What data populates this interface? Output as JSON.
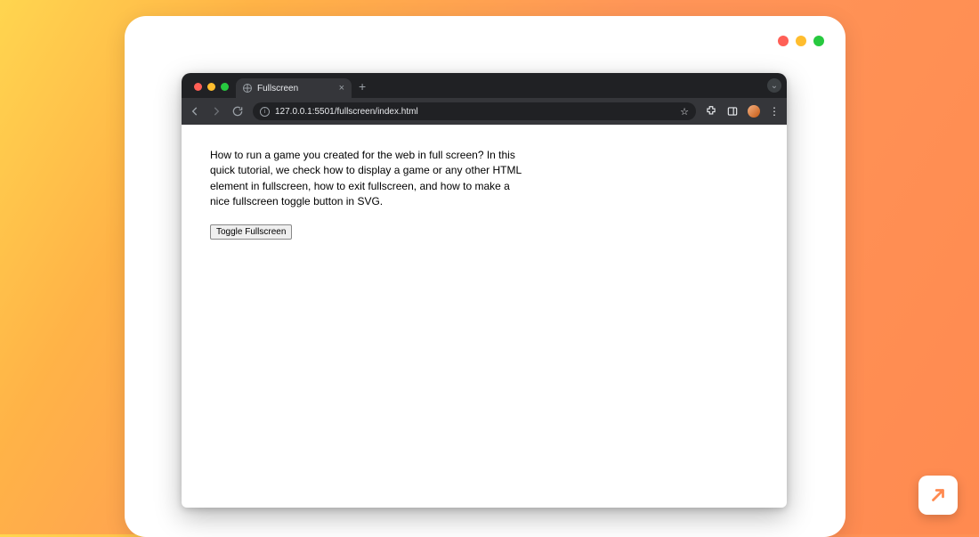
{
  "browser": {
    "tab_title": "Fullscreen",
    "url": "127.0.0.1:5501/fullscreen/index.html"
  },
  "page": {
    "paragraph": "How to run a game you created for the web in full screen? In this quick tutorial, we check how to display a game or any other HTML element in fullscreen, how to exit fullscreen, and how to make a nice fullscreen toggle button in SVG.",
    "button_label": "Toggle Fullscreen"
  }
}
